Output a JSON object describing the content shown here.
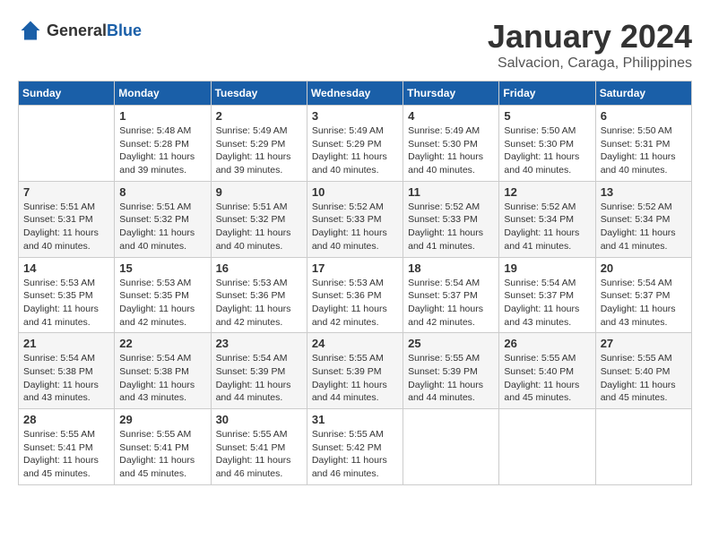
{
  "header": {
    "logo_general": "General",
    "logo_blue": "Blue",
    "month_title": "January 2024",
    "location": "Salvacion, Caraga, Philippines"
  },
  "weekdays": [
    "Sunday",
    "Monday",
    "Tuesday",
    "Wednesday",
    "Thursday",
    "Friday",
    "Saturday"
  ],
  "weeks": [
    [
      {
        "day": "",
        "sunrise": "",
        "sunset": "",
        "daylight": ""
      },
      {
        "day": "1",
        "sunrise": "Sunrise: 5:48 AM",
        "sunset": "Sunset: 5:28 PM",
        "daylight": "Daylight: 11 hours and 39 minutes."
      },
      {
        "day": "2",
        "sunrise": "Sunrise: 5:49 AM",
        "sunset": "Sunset: 5:29 PM",
        "daylight": "Daylight: 11 hours and 39 minutes."
      },
      {
        "day": "3",
        "sunrise": "Sunrise: 5:49 AM",
        "sunset": "Sunset: 5:29 PM",
        "daylight": "Daylight: 11 hours and 40 minutes."
      },
      {
        "day": "4",
        "sunrise": "Sunrise: 5:49 AM",
        "sunset": "Sunset: 5:30 PM",
        "daylight": "Daylight: 11 hours and 40 minutes."
      },
      {
        "day": "5",
        "sunrise": "Sunrise: 5:50 AM",
        "sunset": "Sunset: 5:30 PM",
        "daylight": "Daylight: 11 hours and 40 minutes."
      },
      {
        "day": "6",
        "sunrise": "Sunrise: 5:50 AM",
        "sunset": "Sunset: 5:31 PM",
        "daylight": "Daylight: 11 hours and 40 minutes."
      }
    ],
    [
      {
        "day": "7",
        "sunrise": "Sunrise: 5:51 AM",
        "sunset": "Sunset: 5:31 PM",
        "daylight": "Daylight: 11 hours and 40 minutes."
      },
      {
        "day": "8",
        "sunrise": "Sunrise: 5:51 AM",
        "sunset": "Sunset: 5:32 PM",
        "daylight": "Daylight: 11 hours and 40 minutes."
      },
      {
        "day": "9",
        "sunrise": "Sunrise: 5:51 AM",
        "sunset": "Sunset: 5:32 PM",
        "daylight": "Daylight: 11 hours and 40 minutes."
      },
      {
        "day": "10",
        "sunrise": "Sunrise: 5:52 AM",
        "sunset": "Sunset: 5:33 PM",
        "daylight": "Daylight: 11 hours and 40 minutes."
      },
      {
        "day": "11",
        "sunrise": "Sunrise: 5:52 AM",
        "sunset": "Sunset: 5:33 PM",
        "daylight": "Daylight: 11 hours and 41 minutes."
      },
      {
        "day": "12",
        "sunrise": "Sunrise: 5:52 AM",
        "sunset": "Sunset: 5:34 PM",
        "daylight": "Daylight: 11 hours and 41 minutes."
      },
      {
        "day": "13",
        "sunrise": "Sunrise: 5:52 AM",
        "sunset": "Sunset: 5:34 PM",
        "daylight": "Daylight: 11 hours and 41 minutes."
      }
    ],
    [
      {
        "day": "14",
        "sunrise": "Sunrise: 5:53 AM",
        "sunset": "Sunset: 5:35 PM",
        "daylight": "Daylight: 11 hours and 41 minutes."
      },
      {
        "day": "15",
        "sunrise": "Sunrise: 5:53 AM",
        "sunset": "Sunset: 5:35 PM",
        "daylight": "Daylight: 11 hours and 42 minutes."
      },
      {
        "day": "16",
        "sunrise": "Sunrise: 5:53 AM",
        "sunset": "Sunset: 5:36 PM",
        "daylight": "Daylight: 11 hours and 42 minutes."
      },
      {
        "day": "17",
        "sunrise": "Sunrise: 5:53 AM",
        "sunset": "Sunset: 5:36 PM",
        "daylight": "Daylight: 11 hours and 42 minutes."
      },
      {
        "day": "18",
        "sunrise": "Sunrise: 5:54 AM",
        "sunset": "Sunset: 5:37 PM",
        "daylight": "Daylight: 11 hours and 42 minutes."
      },
      {
        "day": "19",
        "sunrise": "Sunrise: 5:54 AM",
        "sunset": "Sunset: 5:37 PM",
        "daylight": "Daylight: 11 hours and 43 minutes."
      },
      {
        "day": "20",
        "sunrise": "Sunrise: 5:54 AM",
        "sunset": "Sunset: 5:37 PM",
        "daylight": "Daylight: 11 hours and 43 minutes."
      }
    ],
    [
      {
        "day": "21",
        "sunrise": "Sunrise: 5:54 AM",
        "sunset": "Sunset: 5:38 PM",
        "daylight": "Daylight: 11 hours and 43 minutes."
      },
      {
        "day": "22",
        "sunrise": "Sunrise: 5:54 AM",
        "sunset": "Sunset: 5:38 PM",
        "daylight": "Daylight: 11 hours and 43 minutes."
      },
      {
        "day": "23",
        "sunrise": "Sunrise: 5:54 AM",
        "sunset": "Sunset: 5:39 PM",
        "daylight": "Daylight: 11 hours and 44 minutes."
      },
      {
        "day": "24",
        "sunrise": "Sunrise: 5:55 AM",
        "sunset": "Sunset: 5:39 PM",
        "daylight": "Daylight: 11 hours and 44 minutes."
      },
      {
        "day": "25",
        "sunrise": "Sunrise: 5:55 AM",
        "sunset": "Sunset: 5:39 PM",
        "daylight": "Daylight: 11 hours and 44 minutes."
      },
      {
        "day": "26",
        "sunrise": "Sunrise: 5:55 AM",
        "sunset": "Sunset: 5:40 PM",
        "daylight": "Daylight: 11 hours and 45 minutes."
      },
      {
        "day": "27",
        "sunrise": "Sunrise: 5:55 AM",
        "sunset": "Sunset: 5:40 PM",
        "daylight": "Daylight: 11 hours and 45 minutes."
      }
    ],
    [
      {
        "day": "28",
        "sunrise": "Sunrise: 5:55 AM",
        "sunset": "Sunset: 5:41 PM",
        "daylight": "Daylight: 11 hours and 45 minutes."
      },
      {
        "day": "29",
        "sunrise": "Sunrise: 5:55 AM",
        "sunset": "Sunset: 5:41 PM",
        "daylight": "Daylight: 11 hours and 45 minutes."
      },
      {
        "day": "30",
        "sunrise": "Sunrise: 5:55 AM",
        "sunset": "Sunset: 5:41 PM",
        "daylight": "Daylight: 11 hours and 46 minutes."
      },
      {
        "day": "31",
        "sunrise": "Sunrise: 5:55 AM",
        "sunset": "Sunset: 5:42 PM",
        "daylight": "Daylight: 11 hours and 46 minutes."
      },
      {
        "day": "",
        "sunrise": "",
        "sunset": "",
        "daylight": ""
      },
      {
        "day": "",
        "sunrise": "",
        "sunset": "",
        "daylight": ""
      },
      {
        "day": "",
        "sunrise": "",
        "sunset": "",
        "daylight": ""
      }
    ]
  ]
}
